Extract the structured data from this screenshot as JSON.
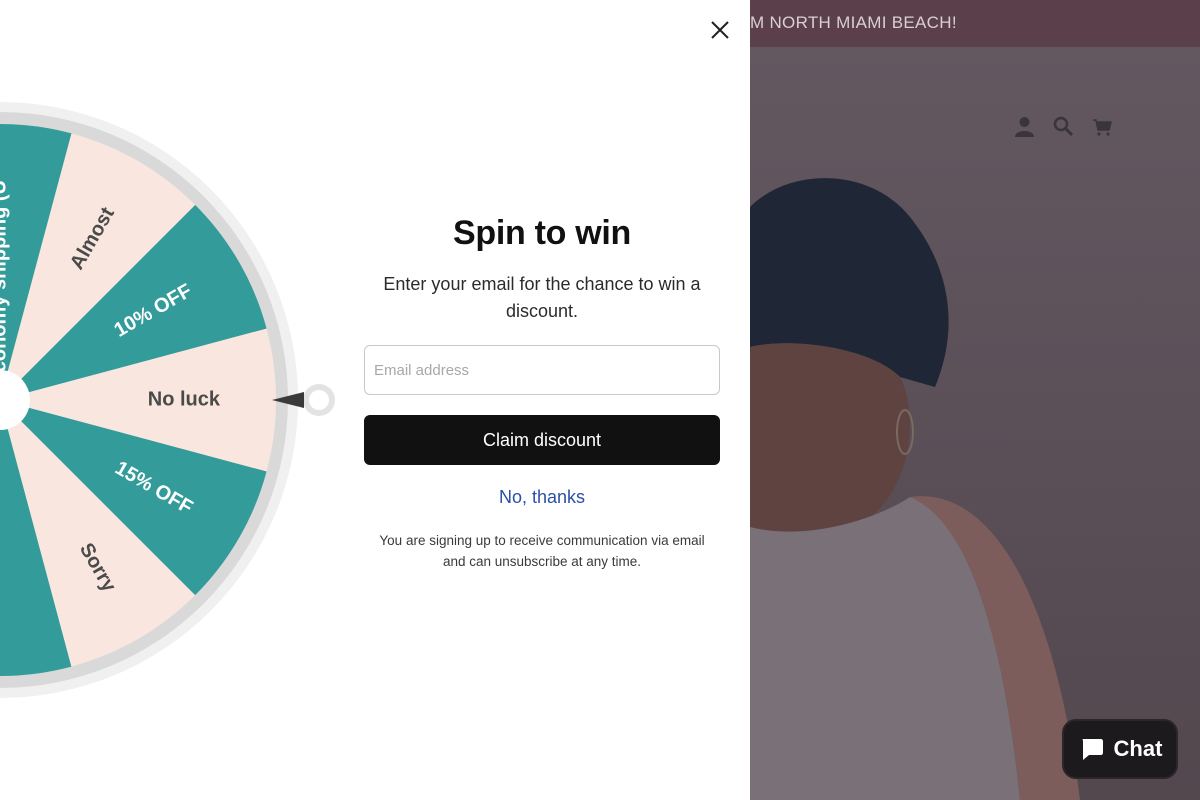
{
  "announcement": {
    "text": "M NORTH MIAMI BEACH!"
  },
  "header": {
    "icons": [
      "account-icon",
      "search-icon",
      "cart-icon"
    ]
  },
  "modal": {
    "close_icon": "close-icon",
    "title": "Spin to win",
    "subtitle": "Enter your email for the chance to win a discount.",
    "email_placeholder": "Email address",
    "claim_label": "Claim discount",
    "no_thanks_label": "No, thanks",
    "disclaimer": "You are signing up to receive communication via email and can unsubscribe at any time."
  },
  "wheel": {
    "colors": {
      "teal": "#339c9a",
      "cream": "#f9e6de",
      "rim": "#d9d9d9"
    },
    "segments": [
      {
        "label": "10% OFF",
        "color": "teal"
      },
      {
        "label": "Almost",
        "color": "cream"
      },
      {
        "label": "Free Economy shipping (U",
        "color": "teal"
      },
      {
        "label": "Sorry..",
        "color": "cream"
      },
      {
        "label": "",
        "color": "teal"
      },
      {
        "label": "",
        "color": "cream"
      },
      {
        "label": "",
        "color": "teal"
      },
      {
        "label": "",
        "color": "cream"
      },
      {
        "label": "",
        "color": "teal"
      },
      {
        "label": "Sorry",
        "color": "cream"
      },
      {
        "label": "15% OFF",
        "color": "teal"
      },
      {
        "label": "No luck",
        "color": "cream"
      }
    ]
  },
  "chat": {
    "label": "Chat",
    "icon": "chat-bubble-icon"
  }
}
